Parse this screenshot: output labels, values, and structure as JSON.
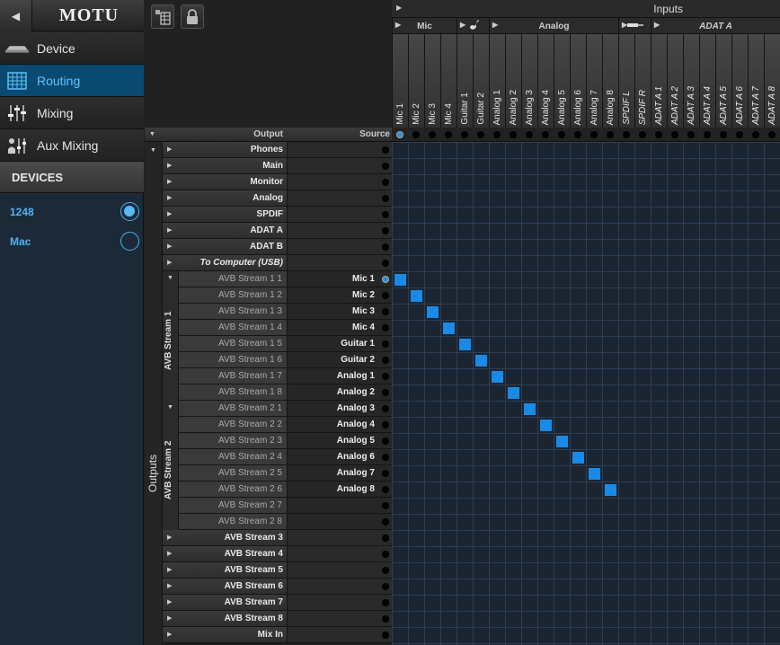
{
  "app": {
    "logo": "MOTU"
  },
  "nav": [
    {
      "label": "Device",
      "icon": "device-icon"
    },
    {
      "label": "Routing",
      "icon": "routing-grid-icon",
      "active": true
    },
    {
      "label": "Mixing",
      "icon": "mixing-faders-icon"
    },
    {
      "label": "Aux Mixing",
      "icon": "aux-mixing-icon"
    }
  ],
  "devices": {
    "header": "DEVICES",
    "items": [
      {
        "label": "1248",
        "selected": true
      },
      {
        "label": "Mac",
        "selected": false
      }
    ]
  },
  "toolbar": {
    "matrix_icon": "matrix-view-icon",
    "lock_icon": "lock-icon"
  },
  "inputs": {
    "title": "Inputs",
    "groups": [
      {
        "label": "Mic",
        "icon": ""
      },
      {
        "label": "",
        "icon": "guitar-icon"
      },
      {
        "label": "Analog",
        "icon": ""
      },
      {
        "label": "",
        "icon": "optical-cable-icon"
      },
      {
        "label": "ADAT A",
        "icon": ""
      }
    ],
    "columns": [
      "Mic 1",
      "Mic 2",
      "Mic 3",
      "Mic 4",
      "Guitar 1",
      "Guitar 2",
      "Analog 1",
      "Analog 2",
      "Analog 3",
      "Analog 4",
      "Analog 5",
      "Analog 6",
      "Analog 7",
      "Analog 8",
      "SPDIF L",
      "SPDIF R",
      "ADAT A 1",
      "ADAT A 2",
      "ADAT A 3",
      "ADAT A 4",
      "ADAT A 5",
      "ADAT A 6",
      "ADAT A 7",
      "ADAT A 8"
    ]
  },
  "outputs": {
    "side_label": "Outputs",
    "header_output": "Output",
    "header_source": "Source",
    "top_groups": [
      "Phones",
      "Main",
      "Monitor",
      "Analog",
      "SPDIF",
      "ADAT A",
      "ADAT B",
      "To Computer (USB)"
    ],
    "stream1": {
      "label": "AVB Stream 1",
      "rows": [
        {
          "name": "AVB Stream 1 1",
          "source": "Mic 1"
        },
        {
          "name": "AVB Stream 1 2",
          "source": "Mic 2"
        },
        {
          "name": "AVB Stream 1 3",
          "source": "Mic 3"
        },
        {
          "name": "AVB Stream 1 4",
          "source": "Mic 4"
        },
        {
          "name": "AVB Stream 1 5",
          "source": "Guitar 1"
        },
        {
          "name": "AVB Stream 1 6",
          "source": "Guitar 2"
        },
        {
          "name": "AVB Stream 1 7",
          "source": "Analog 1"
        },
        {
          "name": "AVB Stream 1 8",
          "source": "Analog 2"
        }
      ]
    },
    "stream2": {
      "label": "AVB Stream 2",
      "rows": [
        {
          "name": "AVB Stream 2 1",
          "source": "Analog 3"
        },
        {
          "name": "AVB Stream 2 2",
          "source": "Analog 4"
        },
        {
          "name": "AVB Stream 2 3",
          "source": "Analog 5"
        },
        {
          "name": "AVB Stream 2 4",
          "source": "Analog 6"
        },
        {
          "name": "AVB Stream 2 5",
          "source": "Analog 7"
        },
        {
          "name": "AVB Stream 2 6",
          "source": "Analog 8"
        },
        {
          "name": "AVB Stream 2 7",
          "source": ""
        },
        {
          "name": "AVB Stream 2 8",
          "source": ""
        }
      ]
    },
    "bottom_groups": [
      "AVB Stream 3",
      "AVB Stream 4",
      "AVB Stream 5",
      "AVB Stream 6",
      "AVB Stream 7",
      "AVB Stream 8",
      "Mix In"
    ]
  },
  "colors": {
    "accent": "#1a8ae6",
    "active_nav": "#0a4a70",
    "grid_line": "#2b3f55"
  }
}
